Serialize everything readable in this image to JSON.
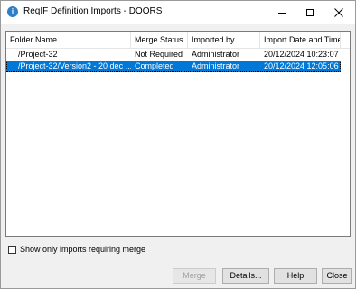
{
  "window": {
    "title": "ReqIF Definition Imports - DOORS",
    "app_icon_glyph": "i"
  },
  "list": {
    "columns": [
      "Folder Name",
      "Merge Status",
      "Imported by",
      "Import Date and Time"
    ],
    "rows": [
      {
        "folder": "/Project-32",
        "merge_status": "Not Required",
        "imported_by": "Administrator",
        "date_time": "20/12/2024 10:23:07",
        "selected": false
      },
      {
        "folder": "/Project-32/Version2 - 20 dec ...",
        "merge_status": "Completed",
        "imported_by": "Administrator",
        "date_time": "20/12/2024 12:05:06",
        "selected": true
      }
    ]
  },
  "filter": {
    "label": "Show only imports requiring merge",
    "checked": false
  },
  "buttons": {
    "merge": "Merge",
    "details": "Details...",
    "help": "Help",
    "close": "Close"
  },
  "colors": {
    "selection": "#0078d7",
    "app_icon": "#2f7fc6"
  }
}
